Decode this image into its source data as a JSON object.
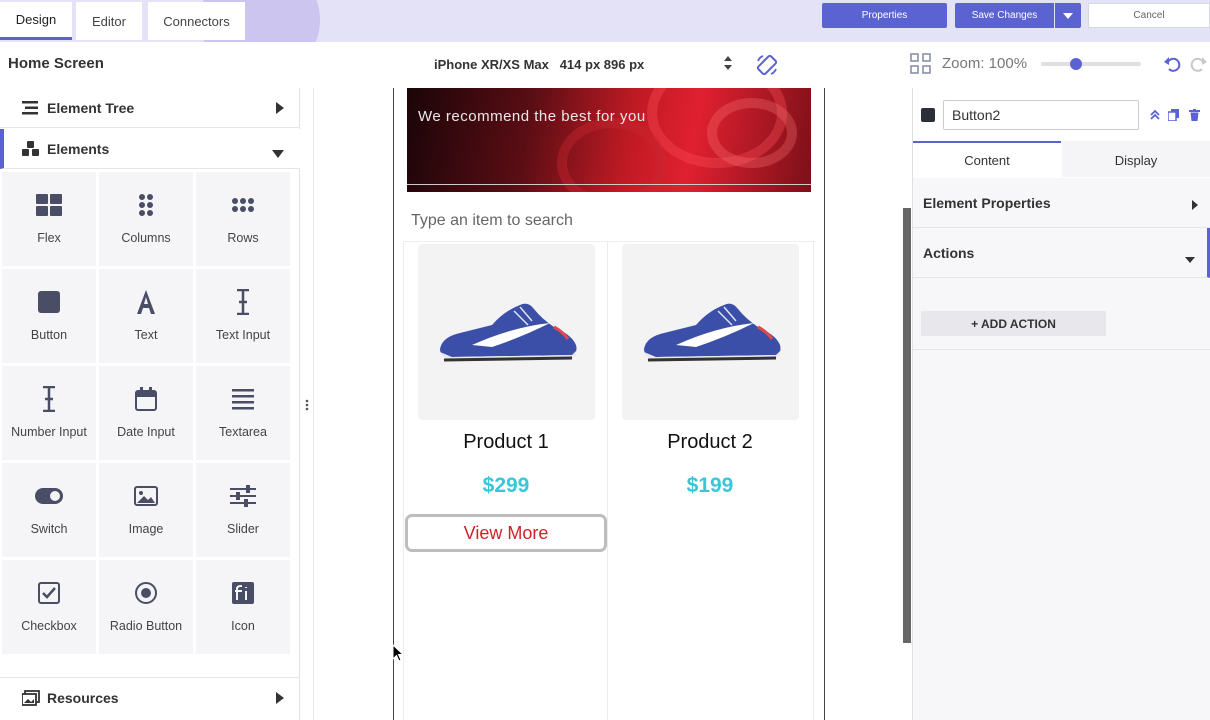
{
  "topbar": {
    "tabs": [
      {
        "label": "Design"
      },
      {
        "label": "Editor"
      },
      {
        "label": "Connectors"
      }
    ],
    "properties_label": "Properties",
    "save_label": "Save Changes",
    "cancel_label": "Cancel"
  },
  "toolbar": {
    "page_title": "Home Screen",
    "device": "iPhone XR/XS Max   414 px 896 px",
    "zoom_label": "Zoom: 100%",
    "zoom_percent": 100
  },
  "left_panel": {
    "element_tree_label": "Element Tree",
    "elements_label": "Elements",
    "resources_label": "Resources",
    "tiles": [
      {
        "label": "Flex",
        "icon": "flex-icon"
      },
      {
        "label": "Columns",
        "icon": "columns-icon"
      },
      {
        "label": "Rows",
        "icon": "rows-icon"
      },
      {
        "label": "Button",
        "icon": "button-icon"
      },
      {
        "label": "Text",
        "icon": "text-icon"
      },
      {
        "label": "Text Input",
        "icon": "text-input-icon"
      },
      {
        "label": "Number Input",
        "icon": "number-input-icon"
      },
      {
        "label": "Date Input",
        "icon": "calendar-icon"
      },
      {
        "label": "Textarea",
        "icon": "textarea-icon"
      },
      {
        "label": "Switch",
        "icon": "switch-icon"
      },
      {
        "label": "Image",
        "icon": "image-icon"
      },
      {
        "label": "Slider",
        "icon": "slider-icon"
      },
      {
        "label": "Checkbox",
        "icon": "checkbox-icon"
      },
      {
        "label": "Radio Button",
        "icon": "radio-icon"
      },
      {
        "label": "Icon",
        "icon": "font-icon"
      }
    ]
  },
  "canvas": {
    "banner_text": "We recommend the best for you",
    "search_placeholder": "Type an item to search",
    "products": [
      {
        "name": "Product 1",
        "price": "$299"
      },
      {
        "name": "Product 2",
        "price": "$199"
      }
    ],
    "view_more_label": "View More"
  },
  "right_panel": {
    "element_name": "Button2",
    "tabs": [
      {
        "label": "Content"
      },
      {
        "label": "Display"
      }
    ],
    "element_properties_label": "Element Properties",
    "actions_label": "Actions",
    "add_action_label": "+ ADD ACTION"
  },
  "colors": {
    "accent": "#5b63d3",
    "price": "#39c6d9",
    "view_more_text": "#d0202a"
  }
}
